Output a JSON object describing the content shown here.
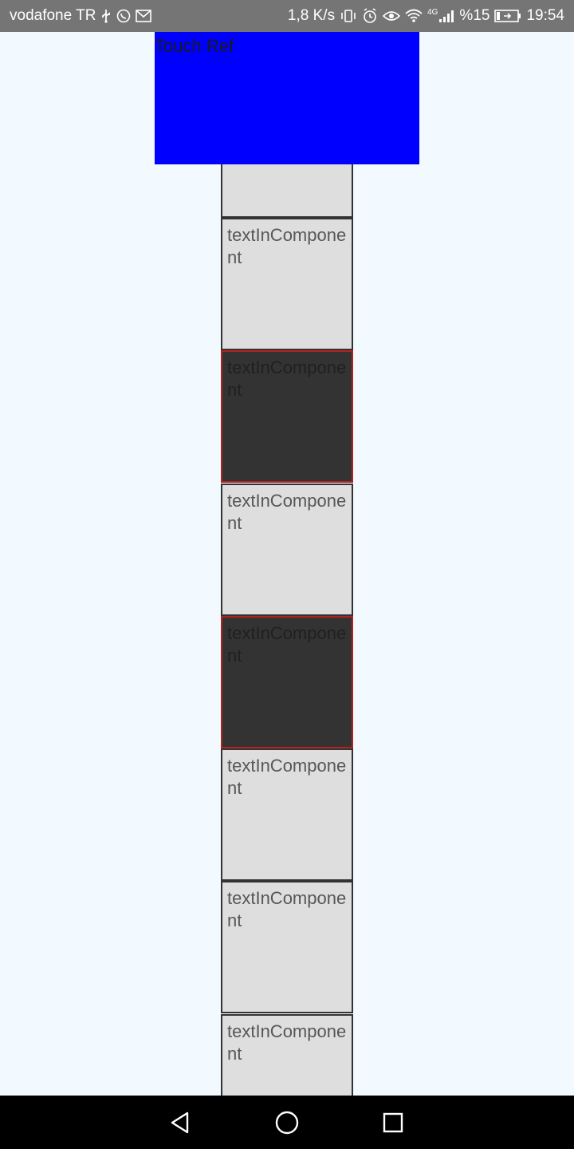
{
  "status_bar": {
    "carrier": "vodafone TR",
    "network_speed": "1,8 K/s",
    "network_type": "4G",
    "battery": "%15",
    "time": "19:54",
    "icons": [
      "usb-icon",
      "whatsapp-icon",
      "gmail-icon",
      "vibrate-icon",
      "alarm-icon",
      "eye-comfort-icon",
      "wifi-icon",
      "signal-icon",
      "battery-charging-icon"
    ]
  },
  "touch_ref": {
    "label": "Touch Ref",
    "color": "#0000ff"
  },
  "list": {
    "items": [
      {
        "text": "",
        "selected": false
      },
      {
        "text": "textInComponent",
        "selected": false
      },
      {
        "text": "textInComponent",
        "selected": true
      },
      {
        "text": "textInComponent",
        "selected": false
      },
      {
        "text": "textInComponent",
        "selected": true
      },
      {
        "text": "textInComponent",
        "selected": false
      },
      {
        "text": "textInComponent",
        "selected": false
      },
      {
        "text": "textInComponent",
        "selected": false
      }
    ],
    "colors": {
      "normal_bg": "#dedede",
      "selected_bg": "#333333",
      "selected_border": "#b22222",
      "border": "#333333"
    }
  },
  "nav_bar": {
    "buttons": [
      "back-icon",
      "home-icon",
      "recents-icon"
    ]
  }
}
